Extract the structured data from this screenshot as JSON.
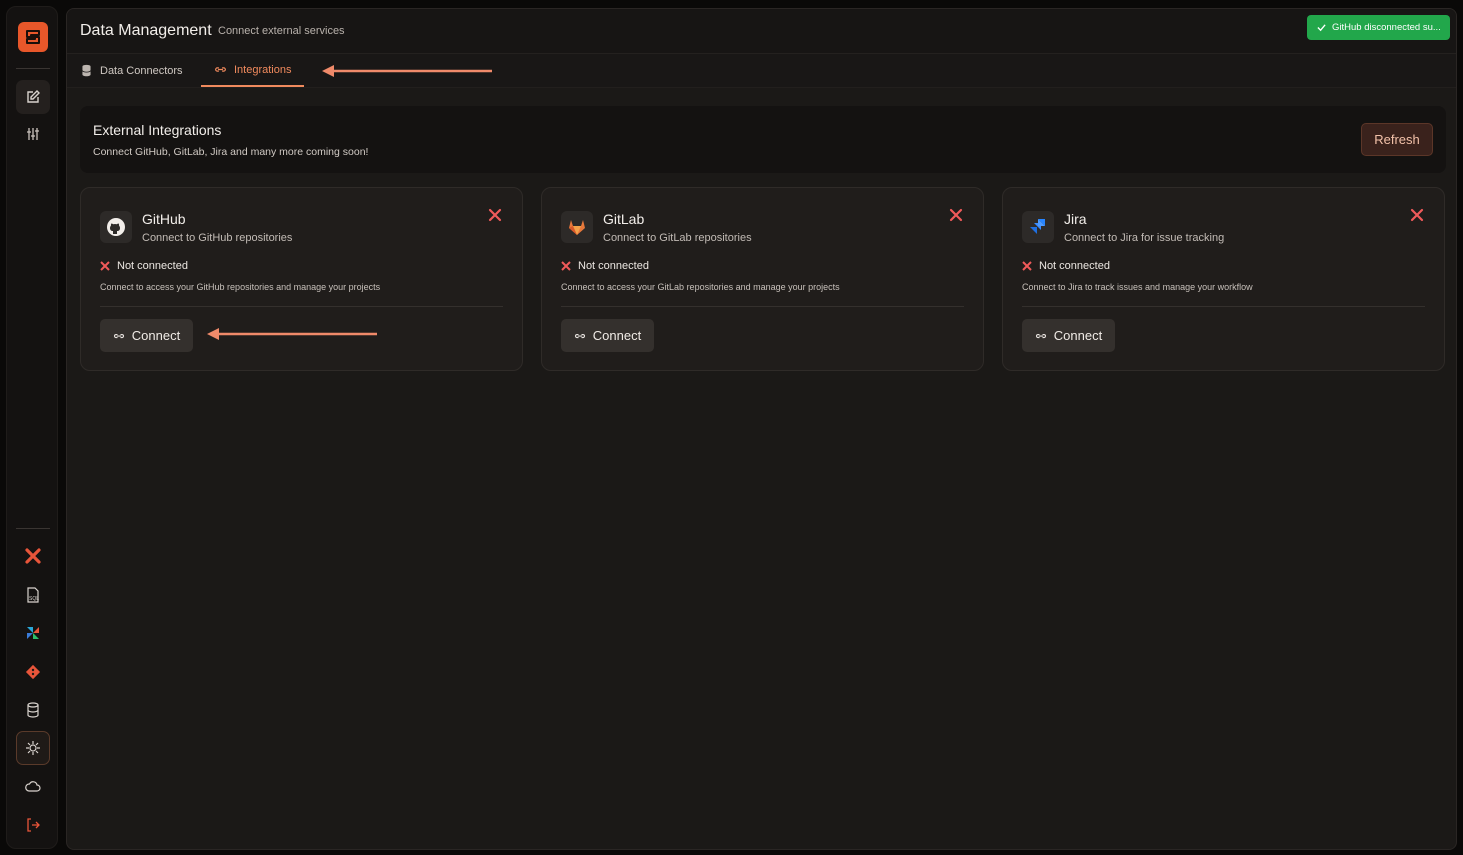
{
  "header": {
    "title": "Data Management",
    "subtitle": "Connect external services"
  },
  "toast": {
    "text": "GitHub disconnected su...",
    "color": "#22a74b"
  },
  "tabs": [
    {
      "label": "Data Connectors",
      "icon": "database-icon",
      "active": false
    },
    {
      "label": "Integrations",
      "icon": "link-icon",
      "active": true
    }
  ],
  "external": {
    "title": "External Integrations",
    "subtitle": "Connect GitHub, GitLab, Jira and many more coming soon!",
    "refresh_label": "Refresh"
  },
  "cards": [
    {
      "name": "GitHub",
      "icon": "github-icon",
      "description": "Connect to GitHub repositories",
      "status": "Not connected",
      "note": "Connect to access your GitHub repositories and manage your projects",
      "button": "Connect"
    },
    {
      "name": "GitLab",
      "icon": "gitlab-icon",
      "description": "Connect to GitLab repositories",
      "status": "Not connected",
      "note": "Connect to access your GitLab repositories and manage your projects",
      "button": "Connect"
    },
    {
      "name": "Jira",
      "icon": "jira-icon",
      "description": "Connect to Jira for issue tracking",
      "status": "Not connected",
      "note": "Connect to Jira to track issues and manage your workflow",
      "button": "Connect"
    }
  ],
  "colors": {
    "accent": "#f08a5d",
    "error": "#f05a5a",
    "brand": "#e8572a"
  }
}
